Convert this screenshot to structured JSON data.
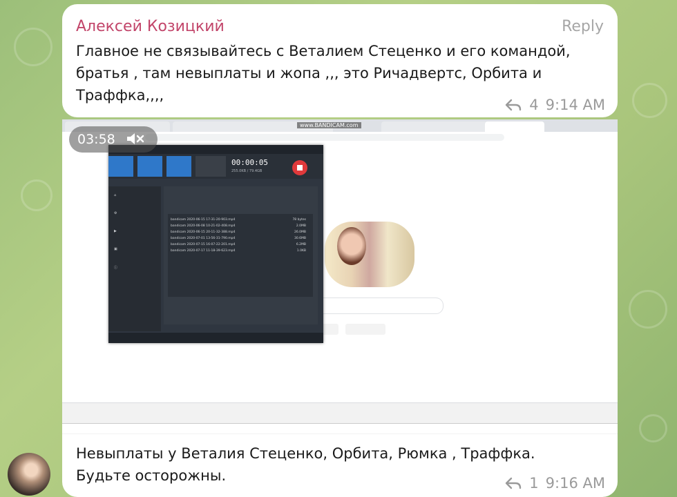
{
  "message1": {
    "sender": "Алексей Козицкий",
    "reply_label": "Reply",
    "text": "Главное не связывайтесь с Веталием Стеценко и его командой,\nбратья , там невыплаты и жопа ,,, это Ричадвертс, Орбита и\nТраффка,,,,",
    "forwards": "4",
    "time": "9:14 AM"
  },
  "media": {
    "overlay_time": "03:58",
    "watermark": "www.BANDICAM.com",
    "bandicam": {
      "timer": "00:00:05",
      "size": "255.0KB / 79.4GB",
      "files": [
        {
          "name": "bandicam 2020-06-15 17-31-20-903.mp4",
          "size": "78 bytes"
        },
        {
          "name": "bandicam 2020-06-08 10-21-02-408.mp4",
          "size": "2.0MB"
        },
        {
          "name": "bandicam 2020-06-15 20-11-32-388.mp4",
          "size": "26.0MB"
        },
        {
          "name": "bandicam 2020-07-01 13-56-31-790.mp4",
          "size": "30.6MB"
        },
        {
          "name": "bandicam 2020-07-15 16-07-22-201.mp4",
          "size": "6.2MB"
        },
        {
          "name": "bandicam 2020-07-17 11-18-39-623.mp4",
          "size": "1.0KB"
        }
      ]
    }
  },
  "message2": {
    "text": "Невыплаты у Веталия Стеценко, Орбита, Рюмка , Траффка.\nБудьте осторожны.",
    "forwards": "1",
    "time": "9:16 AM"
  },
  "colors": {
    "sender": "#c2456a",
    "meta": "#9a9a9a",
    "background": "#a9c57c",
    "bandicam_blue": "#2f78c9",
    "record_red": "#e0393b"
  }
}
